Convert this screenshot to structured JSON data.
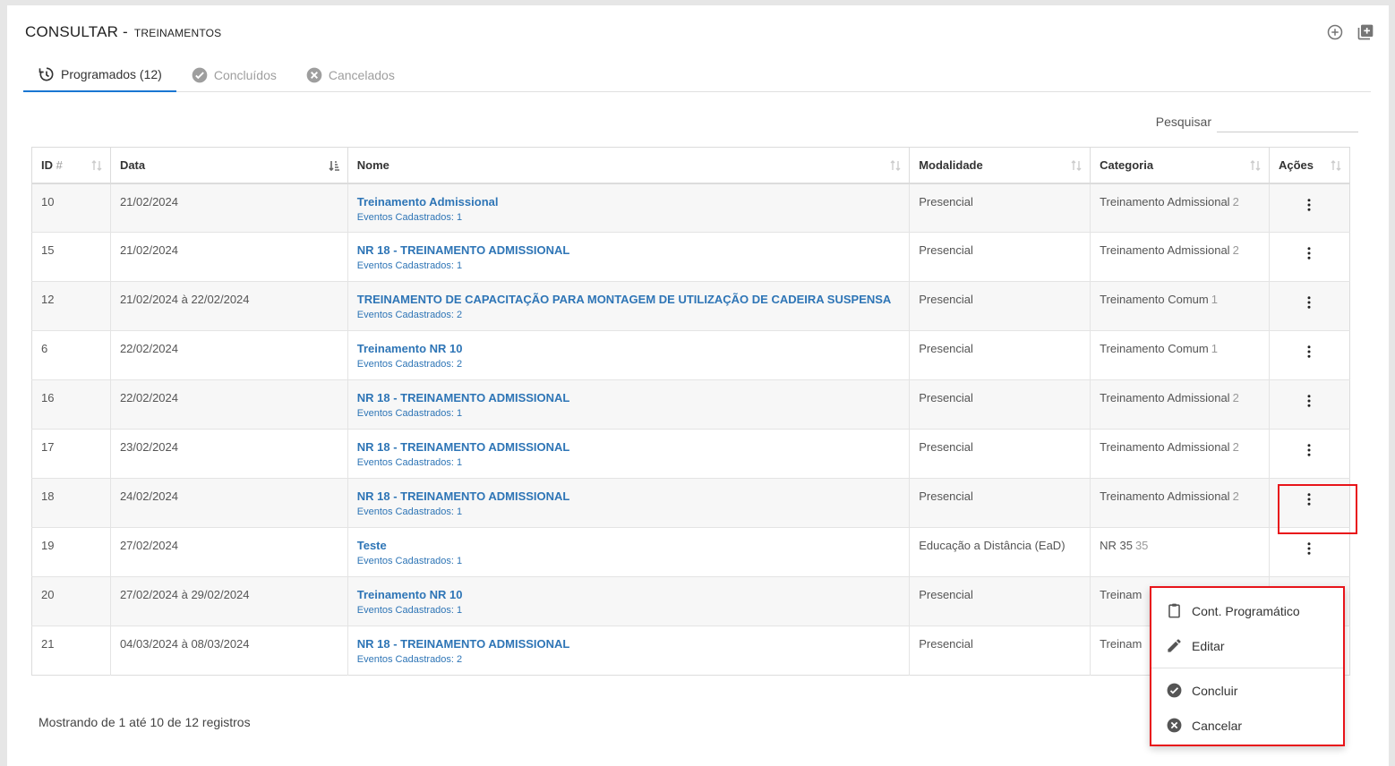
{
  "header": {
    "title": "CONSULTAR -",
    "subtitle": "TREINAMENTOS"
  },
  "tabs": [
    {
      "label": "Programados (12)",
      "icon": "history-icon",
      "active": true
    },
    {
      "label": "Concluídos",
      "icon": "check-circle-icon",
      "active": false
    },
    {
      "label": "Cancelados",
      "icon": "cancel-circle-icon",
      "active": false
    }
  ],
  "search": {
    "label": "Pesquisar",
    "value": "",
    "placeholder": ""
  },
  "table": {
    "columns": {
      "id": "ID",
      "id_hash": "#",
      "data": "Data",
      "nome": "Nome",
      "modalidade": "Modalidade",
      "categoria": "Categoria",
      "acoes": "Ações"
    },
    "rows": [
      {
        "id": "10",
        "data": "21/02/2024",
        "nome": "Treinamento Admissional",
        "eventos": "Eventos Cadastrados: 1",
        "modalidade": "Presencial",
        "categoria": "Treinamento Admissional",
        "cat_count": "2"
      },
      {
        "id": "15",
        "data": "21/02/2024",
        "nome": "NR 18 - TREINAMENTO ADMISSIONAL",
        "eventos": "Eventos Cadastrados: 1",
        "modalidade": "Presencial",
        "categoria": "Treinamento Admissional",
        "cat_count": "2"
      },
      {
        "id": "12",
        "data": "21/02/2024 à 22/02/2024",
        "nome": "TREINAMENTO DE CAPACITAÇÃO PARA MONTAGEM DE UTILIZAÇÃO DE CADEIRA SUSPENSA",
        "eventos": "Eventos Cadastrados: 2",
        "modalidade": "Presencial",
        "categoria": "Treinamento Comum",
        "cat_count": "1"
      },
      {
        "id": "6",
        "data": "22/02/2024",
        "nome": "Treinamento NR 10",
        "eventos": "Eventos Cadastrados: 2",
        "modalidade": "Presencial",
        "categoria": "Treinamento Comum",
        "cat_count": "1"
      },
      {
        "id": "16",
        "data": "22/02/2024",
        "nome": "NR 18 - TREINAMENTO ADMISSIONAL",
        "eventos": "Eventos Cadastrados: 1",
        "modalidade": "Presencial",
        "categoria": "Treinamento Admissional",
        "cat_count": "2"
      },
      {
        "id": "17",
        "data": "23/02/2024",
        "nome": "NR 18 - TREINAMENTO ADMISSIONAL",
        "eventos": "Eventos Cadastrados: 1",
        "modalidade": "Presencial",
        "categoria": "Treinamento Admissional",
        "cat_count": "2"
      },
      {
        "id": "18",
        "data": "24/02/2024",
        "nome": "NR 18 - TREINAMENTO ADMISSIONAL",
        "eventos": "Eventos Cadastrados: 1",
        "modalidade": "Presencial",
        "categoria": "Treinamento Admissional",
        "cat_count": "2"
      },
      {
        "id": "19",
        "data": "27/02/2024",
        "nome": "Teste",
        "eventos": "Eventos Cadastrados: 1",
        "modalidade": "Educação a Distância (EaD)",
        "categoria": "NR 35",
        "cat_count": "35"
      },
      {
        "id": "20",
        "data": "27/02/2024 à 29/02/2024",
        "nome": "Treinamento NR 10",
        "eventos": "Eventos Cadastrados: 1",
        "modalidade": "Presencial",
        "categoria": "Treinam",
        "cat_count": ""
      },
      {
        "id": "21",
        "data": "04/03/2024 à 08/03/2024",
        "nome": "NR 18 - TREINAMENTO ADMISSIONAL",
        "eventos": "Eventos Cadastrados: 2",
        "modalidade": "Presencial",
        "categoria": "Treinam",
        "cat_count": ""
      }
    ]
  },
  "footer": {
    "info": "Mostrando de 1 até 10 de 12 registros"
  },
  "context_menu": {
    "items": [
      {
        "label": "Cont. Programático",
        "icon": "clipboard-icon"
      },
      {
        "label": "Editar",
        "icon": "pencil-icon"
      },
      {
        "label": "Concluir",
        "icon": "check-circle-icon"
      },
      {
        "label": "Cancelar",
        "icon": "cancel-circle-icon"
      }
    ]
  },
  "colors": {
    "link": "#2e75b6",
    "accent": "#1976d2",
    "highlight": "#e8141a"
  }
}
